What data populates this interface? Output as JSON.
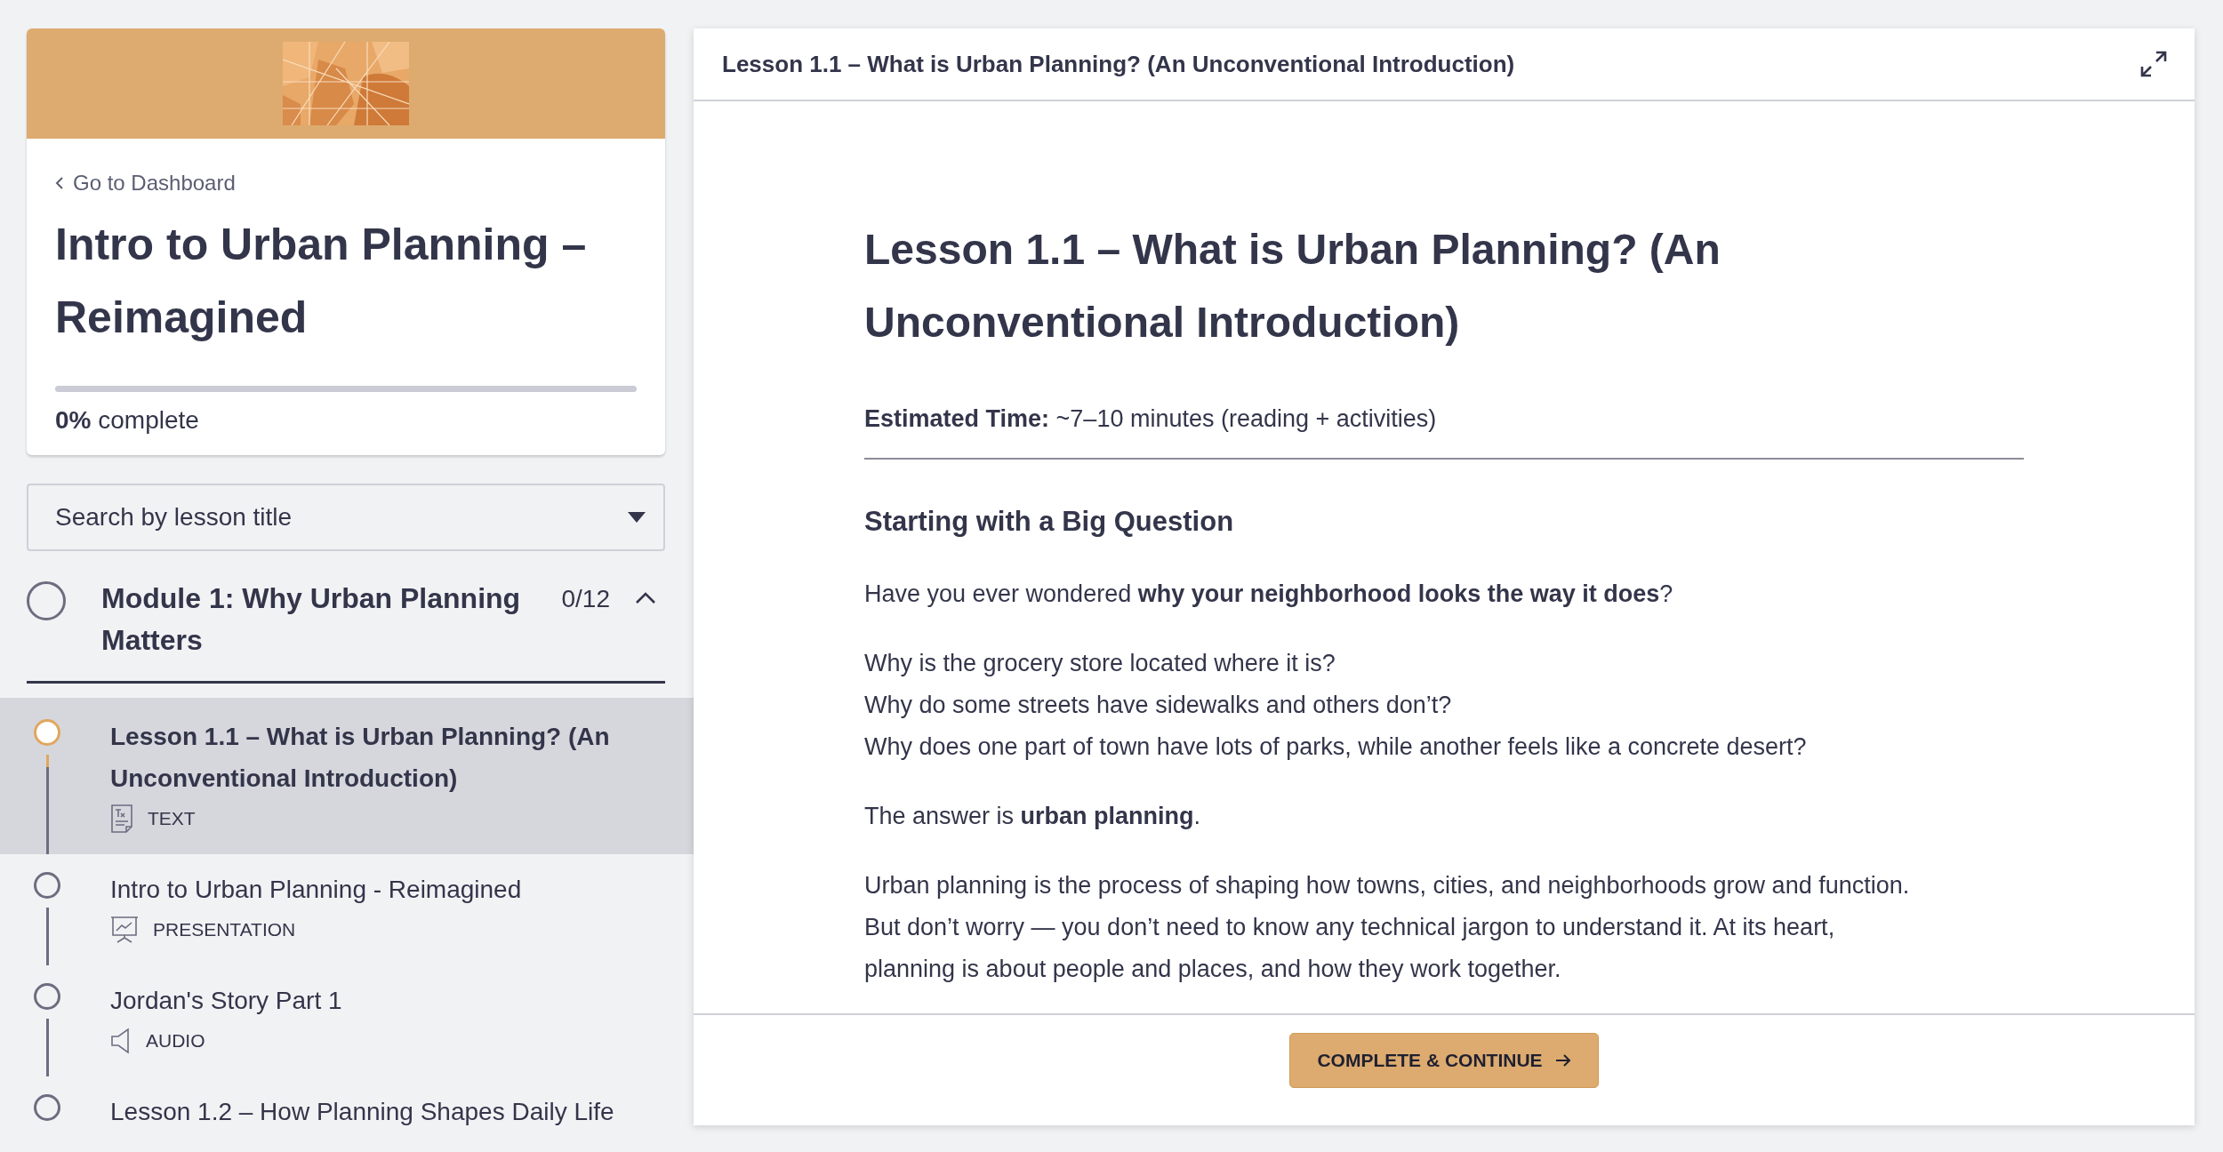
{
  "course": {
    "back_link": "Go to Dashboard",
    "title": "Intro to Urban Planning – Reimagined",
    "progress": {
      "level": 0,
      "text": "**0%** complete"
    }
  },
  "search": {
    "placeholder": "Search by lesson title"
  },
  "module": {
    "title": "Module 1: Why Urban Planning Matters",
    "count": "0/12",
    "expanded": true,
    "completed": false
  },
  "lessons": [
    {
      "title": "Lesson 1.1 – What is Urban Planning? (An Unconventional Introduction)",
      "type": "TEXT",
      "kind": "text",
      "selected": true
    },
    {
      "title": "Intro to Urban Planning - Reimagined",
      "type": "PRESENTATION",
      "kind": "presentation",
      "selected": false
    },
    {
      "title": "Jordan's Story Part 1",
      "type": "AUDIO",
      "kind": "audio",
      "selected": false
    },
    {
      "title": "Lesson 1.2 – How Planning Shapes Daily Life",
      "selected": false
    }
  ],
  "lesson_view": {
    "header_title": "Lesson 1.1 – What is Urban Planning? (An Unconventional Introduction)",
    "heading": "Lesson 1.1 – What is Urban Planning? (An Unconventional Introduction)",
    "estimated": "**Estimated Time:** ~7–10 minutes (reading + activities)",
    "section_title": "Starting with a Big Question",
    "paragraphs": [
      {
        "lines": [
          "Have you ever wondered **why your neighborhood looks the way it does**?"
        ]
      },
      {
        "lines": [
          "Why is the grocery store located where it is?",
          "Why do some streets have sidewalks and others don’t?",
          "Why does one part of town have lots of parks, while another feels like a concrete desert?"
        ]
      },
      {
        "lines": [
          "The answer is **urban planning**."
        ]
      },
      {
        "lines": [
          "Urban planning is the process of shaping how towns, cities, and neighborhoods grow and function.",
          "But don’t worry — you don’t need to know any technical jargon to understand it. At its heart,",
          "planning is about people and places, and how they work together."
        ]
      }
    ],
    "button": "COMPLETE & CONTINUE"
  }
}
